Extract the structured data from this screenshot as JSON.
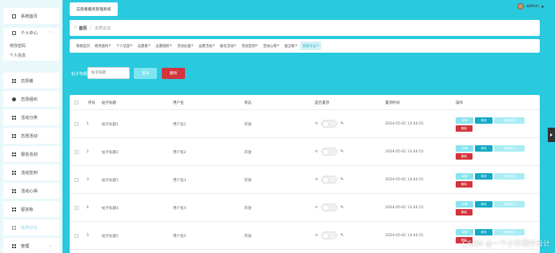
{
  "app": {
    "title": "志愿者服务管理系统"
  },
  "user": {
    "name": "admin"
  },
  "breadcrumb": {
    "home": "首页",
    "current": "资质论坛"
  },
  "sidebar": {
    "items": [
      {
        "label": "系统首页",
        "icon": "home-icon"
      },
      {
        "label": "个人中心",
        "icon": "user-icon",
        "expanded": true
      },
      {
        "label": "修改密码",
        "sub": true
      },
      {
        "label": "个人信息",
        "sub": true
      },
      {
        "label": "志愿者",
        "icon": "grid-icon"
      },
      {
        "label": "志愿组织",
        "icon": "dot-icon"
      },
      {
        "label": "活动分类",
        "icon": "grid-icon"
      },
      {
        "label": "志愿活动",
        "icon": "grid-icon"
      },
      {
        "label": "报名活动",
        "icon": "grid-icon"
      },
      {
        "label": "活动签到",
        "icon": "grid-icon"
      },
      {
        "label": "活动心得",
        "icon": "grid-icon"
      },
      {
        "label": "留言板",
        "icon": "grid-icon"
      },
      {
        "label": "资质论坛",
        "icon": "grid-icon",
        "active": true
      },
      {
        "label": "管理",
        "icon": "grid-icon"
      }
    ]
  },
  "tags": [
    {
      "label": "系统首页"
    },
    {
      "label": "修改密码"
    },
    {
      "label": "个人信息"
    },
    {
      "label": "志愿者"
    },
    {
      "label": "志愿组织"
    },
    {
      "label": "活动分类"
    },
    {
      "label": "志愿活动"
    },
    {
      "label": "报名活动"
    },
    {
      "label": "活动签到"
    },
    {
      "label": "活动心得"
    },
    {
      "label": "留言板"
    },
    {
      "label": "资质论坛",
      "active": true
    }
  ],
  "search": {
    "label": "帖子标题",
    "placeholder": "帖子标题",
    "search_button": "查询",
    "delete_button": "删除"
  },
  "table": {
    "headers": {
      "index": "序号",
      "title": "帖子标题",
      "user": "用户名",
      "status": "状态",
      "pin": "是否置顶",
      "time": "置顶时间",
      "actions": "操作"
    },
    "rows": [
      {
        "index": "1",
        "title": "帖子标题1",
        "user": "用户名1",
        "status": "开放",
        "time": "2024-05-01 13:44:15"
      },
      {
        "index": "2",
        "title": "帖子标题2",
        "user": "用户名2",
        "status": "开放",
        "time": "2024-05-01 13:44:15"
      },
      {
        "index": "3",
        "title": "帖子标题3",
        "user": "用户名3",
        "status": "开放",
        "time": "2024-05-01 13:44:15"
      },
      {
        "index": "4",
        "title": "帖子标题4",
        "user": "用户名4",
        "status": "开放",
        "time": "2024-05-01 13:44:15"
      },
      {
        "index": "5",
        "title": "帖子标题5",
        "user": "用户名5",
        "status": "开放",
        "time": "2024-05-01 13:44:15"
      }
    ],
    "action_labels": {
      "detail": "详情",
      "edit": "修改",
      "review": "查看评论",
      "delete": "删除"
    }
  },
  "watermark": "CSDN @一个小许程序设计"
}
